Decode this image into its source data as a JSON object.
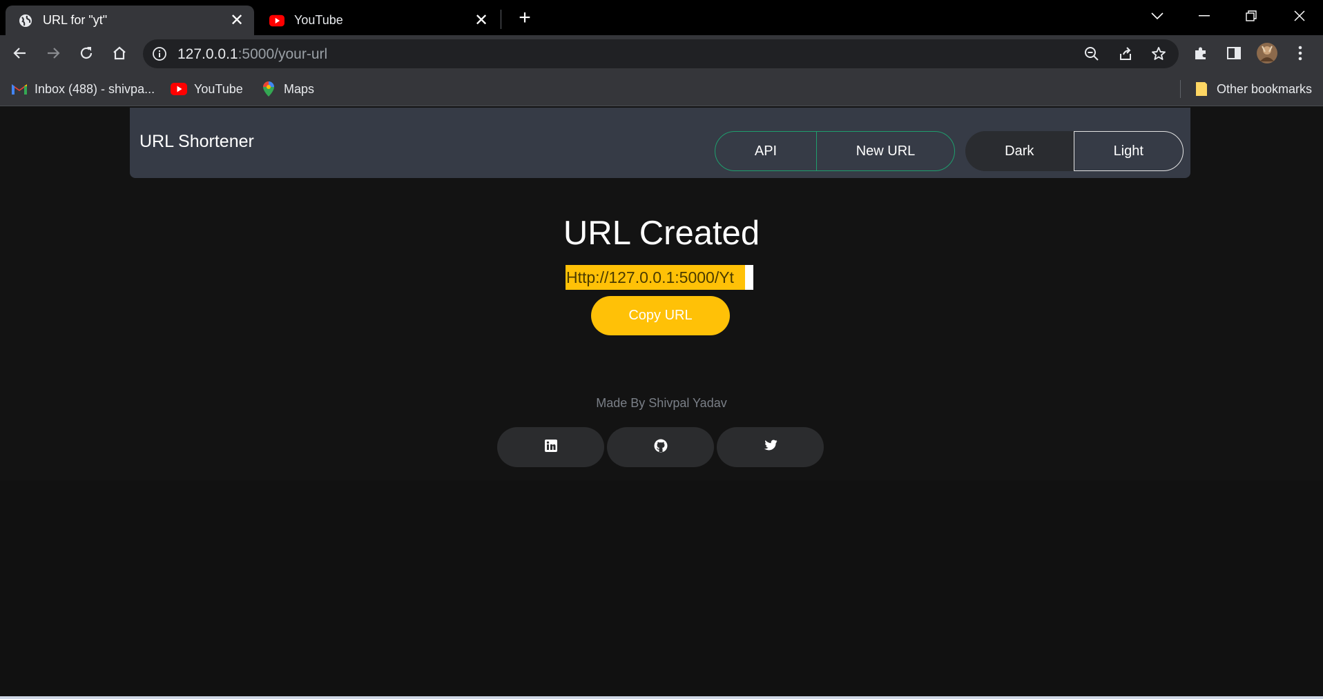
{
  "browser": {
    "tabs": [
      {
        "title": "URL for \"yt\"",
        "icon": "globe-icon",
        "active": true
      },
      {
        "title": "YouTube",
        "icon": "youtube-icon",
        "active": false
      }
    ],
    "close_glyph": "✕",
    "new_tab_glyph": "+",
    "address": {
      "host": "127.0.0.1",
      "path": ":5000/your-url"
    },
    "bookmarks": [
      {
        "label": "Inbox (488) - shivpa...",
        "icon": "gmail-icon"
      },
      {
        "label": "YouTube",
        "icon": "youtube-icon"
      },
      {
        "label": "Maps",
        "icon": "maps-icon"
      }
    ],
    "other_bookmarks": "Other bookmarks"
  },
  "app": {
    "brand": "URL Shortener",
    "nav": {
      "api": "API",
      "new_url": "New URL",
      "dark": "Dark",
      "light": "Light"
    },
    "heading": "URL Created",
    "short_url": "Http://127.0.0.1:5000/Yt",
    "copy_button": "Copy URL",
    "footer": "Made By Shivpal Yadav",
    "social": [
      "linkedin-icon",
      "github-icon",
      "twitter-icon"
    ]
  },
  "colors": {
    "accent": "#ffc107",
    "navbar": "#363b46",
    "outline_green": "#1e9f6e"
  }
}
